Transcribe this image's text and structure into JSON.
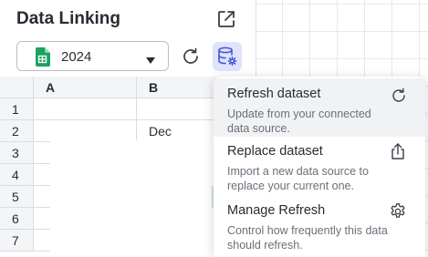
{
  "panel": {
    "title": "Data Linking",
    "dataset_select": {
      "value": "2024"
    }
  },
  "grid": {
    "columns": [
      "A",
      "B"
    ],
    "rows": [
      "1",
      "2",
      "3",
      "4",
      "5",
      "6",
      "7"
    ],
    "cells": {
      "B2": "Dec"
    }
  },
  "menu": {
    "items": [
      {
        "title": "Refresh dataset",
        "description": "Update from your connected data source.",
        "icon": "refresh-icon"
      },
      {
        "title": "Replace dataset",
        "description": "Import a new data source to replace your current one.",
        "icon": "upload-icon"
      },
      {
        "title": "Manage Refresh",
        "description": "Control how frequently this data should refresh.",
        "icon": "gear-icon"
      }
    ]
  },
  "colors": {
    "accent_bg": "#dfe3fb",
    "sheet_green": "#1aa260",
    "menu_hover": "#f1f2f4"
  }
}
